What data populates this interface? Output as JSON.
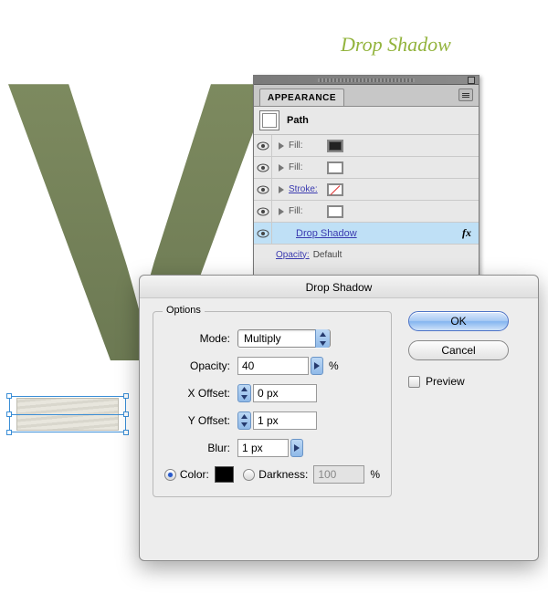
{
  "annotation": {
    "title": "Drop Shadow",
    "letter": "V"
  },
  "appearance": {
    "tab_label": "APPEARANCE",
    "path_label": "Path",
    "rows": [
      {
        "label": "Fill:",
        "link": false,
        "swatch": "dark"
      },
      {
        "label": "Fill:",
        "link": false,
        "swatch": "white"
      },
      {
        "label": "Stroke:",
        "link": true,
        "swatch": "none"
      },
      {
        "label": "Fill:",
        "link": false,
        "swatch": "white"
      }
    ],
    "drop_shadow_label": "Drop Shadow",
    "fx_label": "fx",
    "opacity_label": "Opacity:",
    "opacity_value": "Default"
  },
  "dialog": {
    "title": "Drop Shadow",
    "legend": "Options",
    "mode_label": "Mode:",
    "mode_value": "Multiply",
    "opacity_label": "Opacity:",
    "opacity_value": "40",
    "opacity_unit": "%",
    "xoffset_label": "X Offset:",
    "xoffset_value": "0 px",
    "yoffset_label": "Y Offset:",
    "yoffset_value": "1 px",
    "blur_label": "Blur:",
    "blur_value": "1 px",
    "color_label": "Color:",
    "darkness_label": "Darkness:",
    "darkness_value": "100",
    "darkness_unit": "%",
    "ok_label": "OK",
    "cancel_label": "Cancel",
    "preview_label": "Preview"
  }
}
